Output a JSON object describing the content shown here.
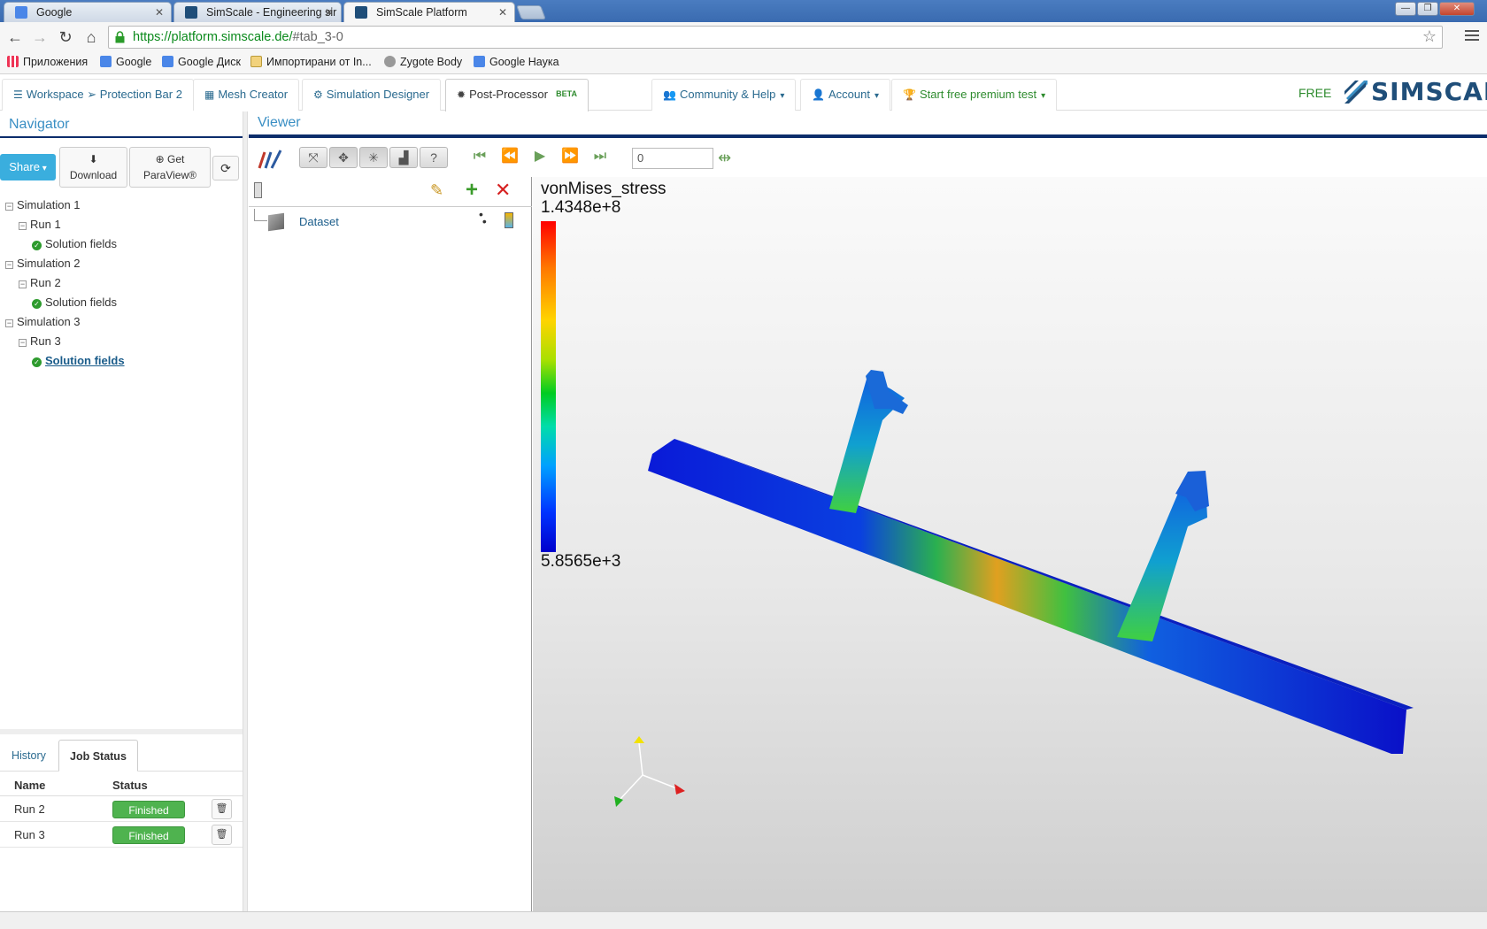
{
  "browser": {
    "tabs": [
      {
        "title": "Google"
      },
      {
        "title": "SimScale - Engineering sir"
      },
      {
        "title": "SimScale Platform"
      }
    ],
    "url_host": "https://platform.simscale.de/",
    "url_rest": "#tab_3-0",
    "bookmarks": [
      "Приложения",
      "Google",
      "Google Диск",
      "Импортирани от In...",
      "Zygote Body",
      "Google Наука"
    ]
  },
  "appnav": {
    "workspace": "Workspace",
    "project": "Protection Bar 2",
    "mesh": "Mesh Creator",
    "simdesigner": "Simulation Designer",
    "postprocessor": "Post-Processor",
    "beta": "BETA",
    "community": "Community & Help",
    "account": "Account",
    "premium": "Start free premium test",
    "free": "FREE",
    "logo": "SIMSCALE"
  },
  "navigator": {
    "title": "Navigator",
    "share": "Share",
    "download": "Download",
    "get": "Get",
    "paraview": "ParaView®",
    "tree": [
      {
        "label": "Simulation 1",
        "run": "Run 1",
        "field": "Solution fields"
      },
      {
        "label": "Simulation 2",
        "run": "Run 2",
        "field": "Solution fields"
      },
      {
        "label": "Simulation 3",
        "run": "Run 3",
        "field": "Solution fields"
      }
    ]
  },
  "jobs": {
    "tab_history": "History",
    "tab_status": "Job Status",
    "col_name": "Name",
    "col_status": "Status",
    "rows": [
      {
        "name": "Run 2",
        "status": "Finished"
      },
      {
        "name": "Run 3",
        "status": "Finished"
      }
    ]
  },
  "viewer": {
    "title": "Viewer",
    "time_value": "0",
    "dataset": "Dataset",
    "legend": {
      "field": "vonMises_stress",
      "max": "1.4348e+8",
      "min": "5.8565e+3"
    }
  },
  "colors": {
    "accent": "#3a8fc4",
    "navy": "#0c2d6b",
    "success": "#4fb34f",
    "share": "#3aaede"
  }
}
